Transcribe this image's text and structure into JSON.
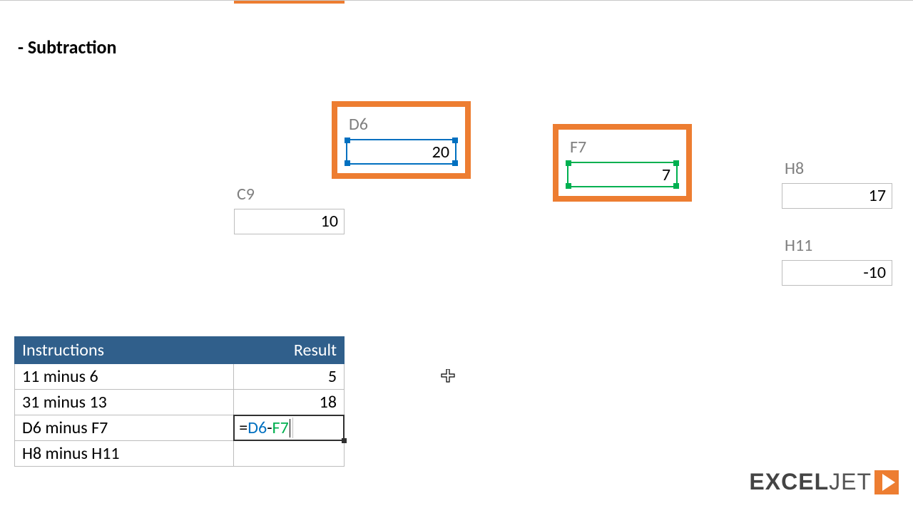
{
  "title": "- Subtraction",
  "cells": {
    "D6": {
      "label": "D6",
      "value": "20"
    },
    "F7": {
      "label": "F7",
      "value": "7"
    },
    "C9": {
      "label": "C9",
      "value": "10"
    },
    "H8": {
      "label": "H8",
      "value": "17"
    },
    "H11": {
      "label": "H11",
      "value": "-10"
    }
  },
  "table": {
    "headers": {
      "instructions": "Instructions",
      "result": "Result"
    },
    "rows": [
      {
        "instruction": "11 minus 6",
        "result": "5"
      },
      {
        "instruction": "31 minus 13",
        "result": "18"
      },
      {
        "instruction": "D6 minus F7",
        "result_formula": {
          "eq": "=",
          "ref1": "D6",
          "op": "-",
          "ref2": "F7"
        }
      },
      {
        "instruction": "H8 minus H11",
        "result": ""
      }
    ]
  },
  "logo": {
    "part1": "EXCEL",
    "part2": "JET"
  }
}
